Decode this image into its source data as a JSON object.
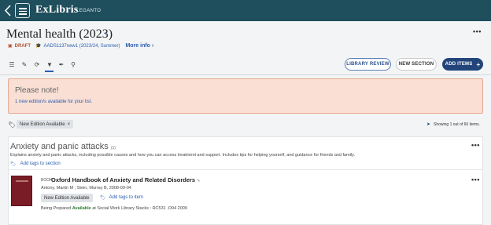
{
  "header": {
    "brand": "ExLibris",
    "product": "LEGANTO"
  },
  "list": {
    "title": "Mental health (2023)",
    "status": "DRAFT",
    "course": "AADS1137new1 (2023/24, Summer)",
    "more_info": "More info"
  },
  "toolbar": {
    "library_review": "LIBRARY REVIEW",
    "new_section": "NEW SECTION",
    "add_items": "ADD ITEMS"
  },
  "note": {
    "title": "Please note!",
    "message": "1 new edition/s available for your list."
  },
  "filter": {
    "tag_chip": "New Edition Available",
    "remove": "×",
    "showing": "Showing 1 out of 60 items."
  },
  "section": {
    "title": "Anxiety and panic attacks",
    "count": "(1)",
    "description": "Explains anxiety and panic attacks, including possible causes and how you can access treatment and support. Includes tips for helping yourself, and guidance for friends and family.",
    "add_tags": "Add tags to section"
  },
  "item": {
    "type": "BOOK",
    "title": "Oxford Handbook of Anxiety and Related Disorders",
    "authors": "Antony, Martin M ; Stein, Murray B, 2008-09-04",
    "tag_chip": "New Edition Available",
    "add_tags": "Add tags to item",
    "status_prepared": "Being Prepared",
    "status_available": "Available",
    "location": "at Social Work Library Stacks : RC531 .O94 2009"
  },
  "colors": {
    "topbar": "#1f4e5c",
    "primary_button": "#21457a",
    "note_background": "#f9dfd4",
    "draft": "#b5522b",
    "available": "#2e7d32"
  },
  "icons": [
    "back-icon",
    "hamburger-icon",
    "edit-icon",
    "list-view-icon",
    "edit-list-icon",
    "refresh-icon",
    "filter-icon",
    "pin-icon",
    "search-icon",
    "more-options-icon",
    "plus-icon",
    "tag-icon",
    "sort-icon",
    "close-icon"
  ]
}
